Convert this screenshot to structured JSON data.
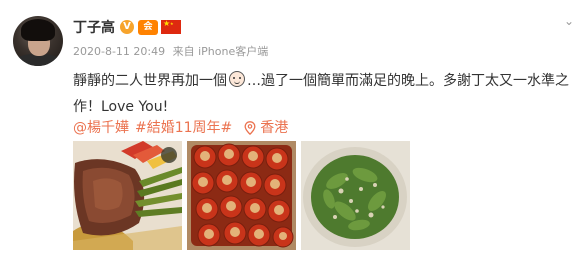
{
  "post": {
    "username": "丁子高",
    "badges": {
      "verified": "V",
      "member": "会"
    },
    "meta": {
      "time": "2020-8-11 20:49",
      "source": "来自 iPhone客户端"
    },
    "content": {
      "line_part_1": "靜靜的二人世界再加一個",
      "line_part_2": "…過了一個簡單而滿足的晚上。多謝丁太又一水準之作！Love You!"
    },
    "tags": {
      "mention": "@楊千嬅",
      "hashtag": "#結婚11周年#",
      "location": "香港"
    },
    "icons": {
      "menu": "chevron-down-icon",
      "emoji": "smile-emoji-icon",
      "location": "location-pin-icon",
      "flag": "china-flag-icon"
    },
    "photos": [
      {
        "name": "steak-with-asparagus"
      },
      {
        "name": "baked-tomatoes-with-garlic"
      },
      {
        "name": "spinach-salad"
      }
    ],
    "colors": {
      "link": "#eb7350",
      "meta": "#999999",
      "text": "#333333",
      "verified": "#f7a42c"
    }
  }
}
